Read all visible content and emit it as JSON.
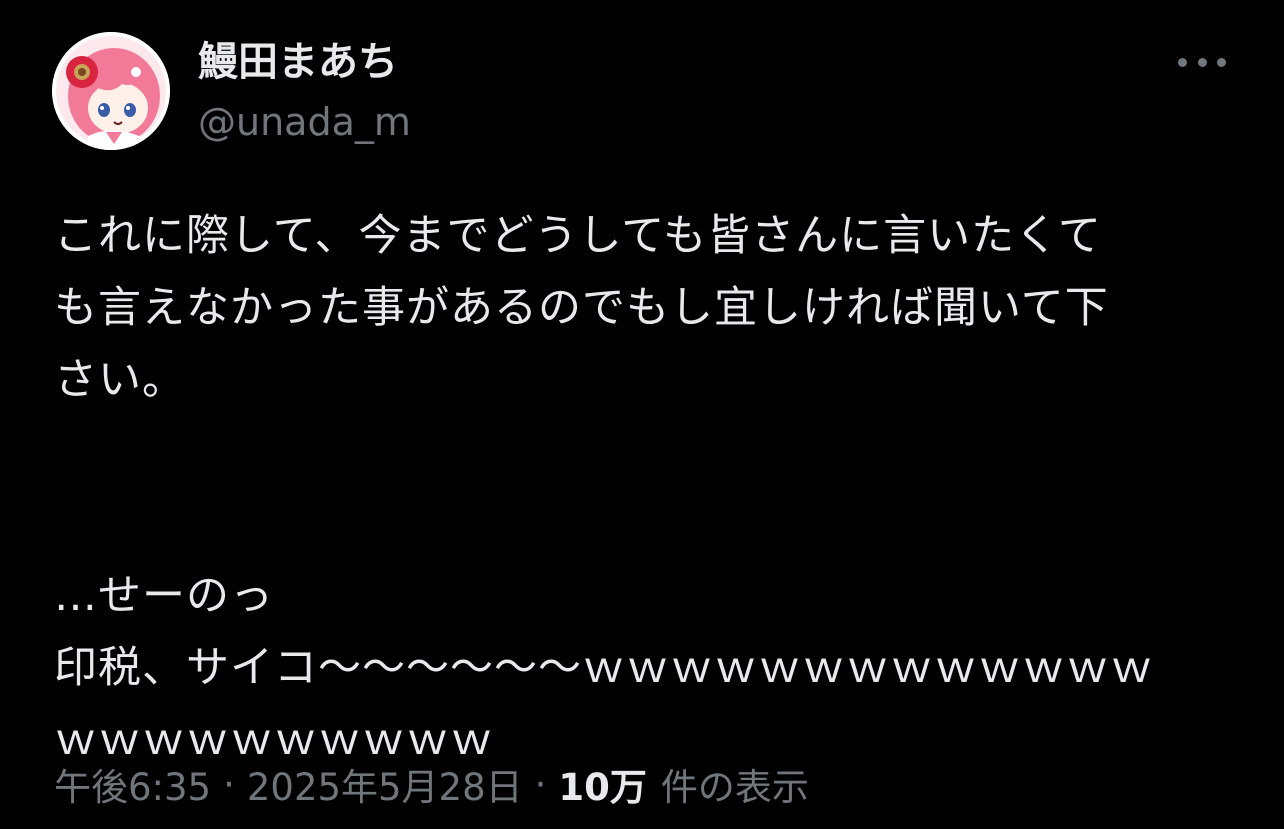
{
  "author": {
    "display_name": "鰻田まあち",
    "handle": "@unada_m"
  },
  "tweet": {
    "lines": [
      "これに際して、今までどうしても皆さんに言いたくて",
      "も言えなかった事があるのでもし宜しければ聞いて下",
      "さい。",
      "…せーのっ",
      "印税、サイコ〜〜〜〜〜〜ｗｗｗｗｗｗｗｗｗｗｗｗｗ",
      "ｗｗｗｗｗｗｗｗｗｗ"
    ]
  },
  "meta": {
    "time": "午後6:35",
    "separator": "·",
    "date": "2025年5月28日",
    "views_count": "10万",
    "views_label": "件の表示"
  },
  "icons": {
    "more": "more-horizontal-icon"
  },
  "colors": {
    "background": "#000000",
    "primary_text": "#e7e9ea",
    "secondary_text": "#71767b",
    "avatar_hair": "#f27a98"
  }
}
